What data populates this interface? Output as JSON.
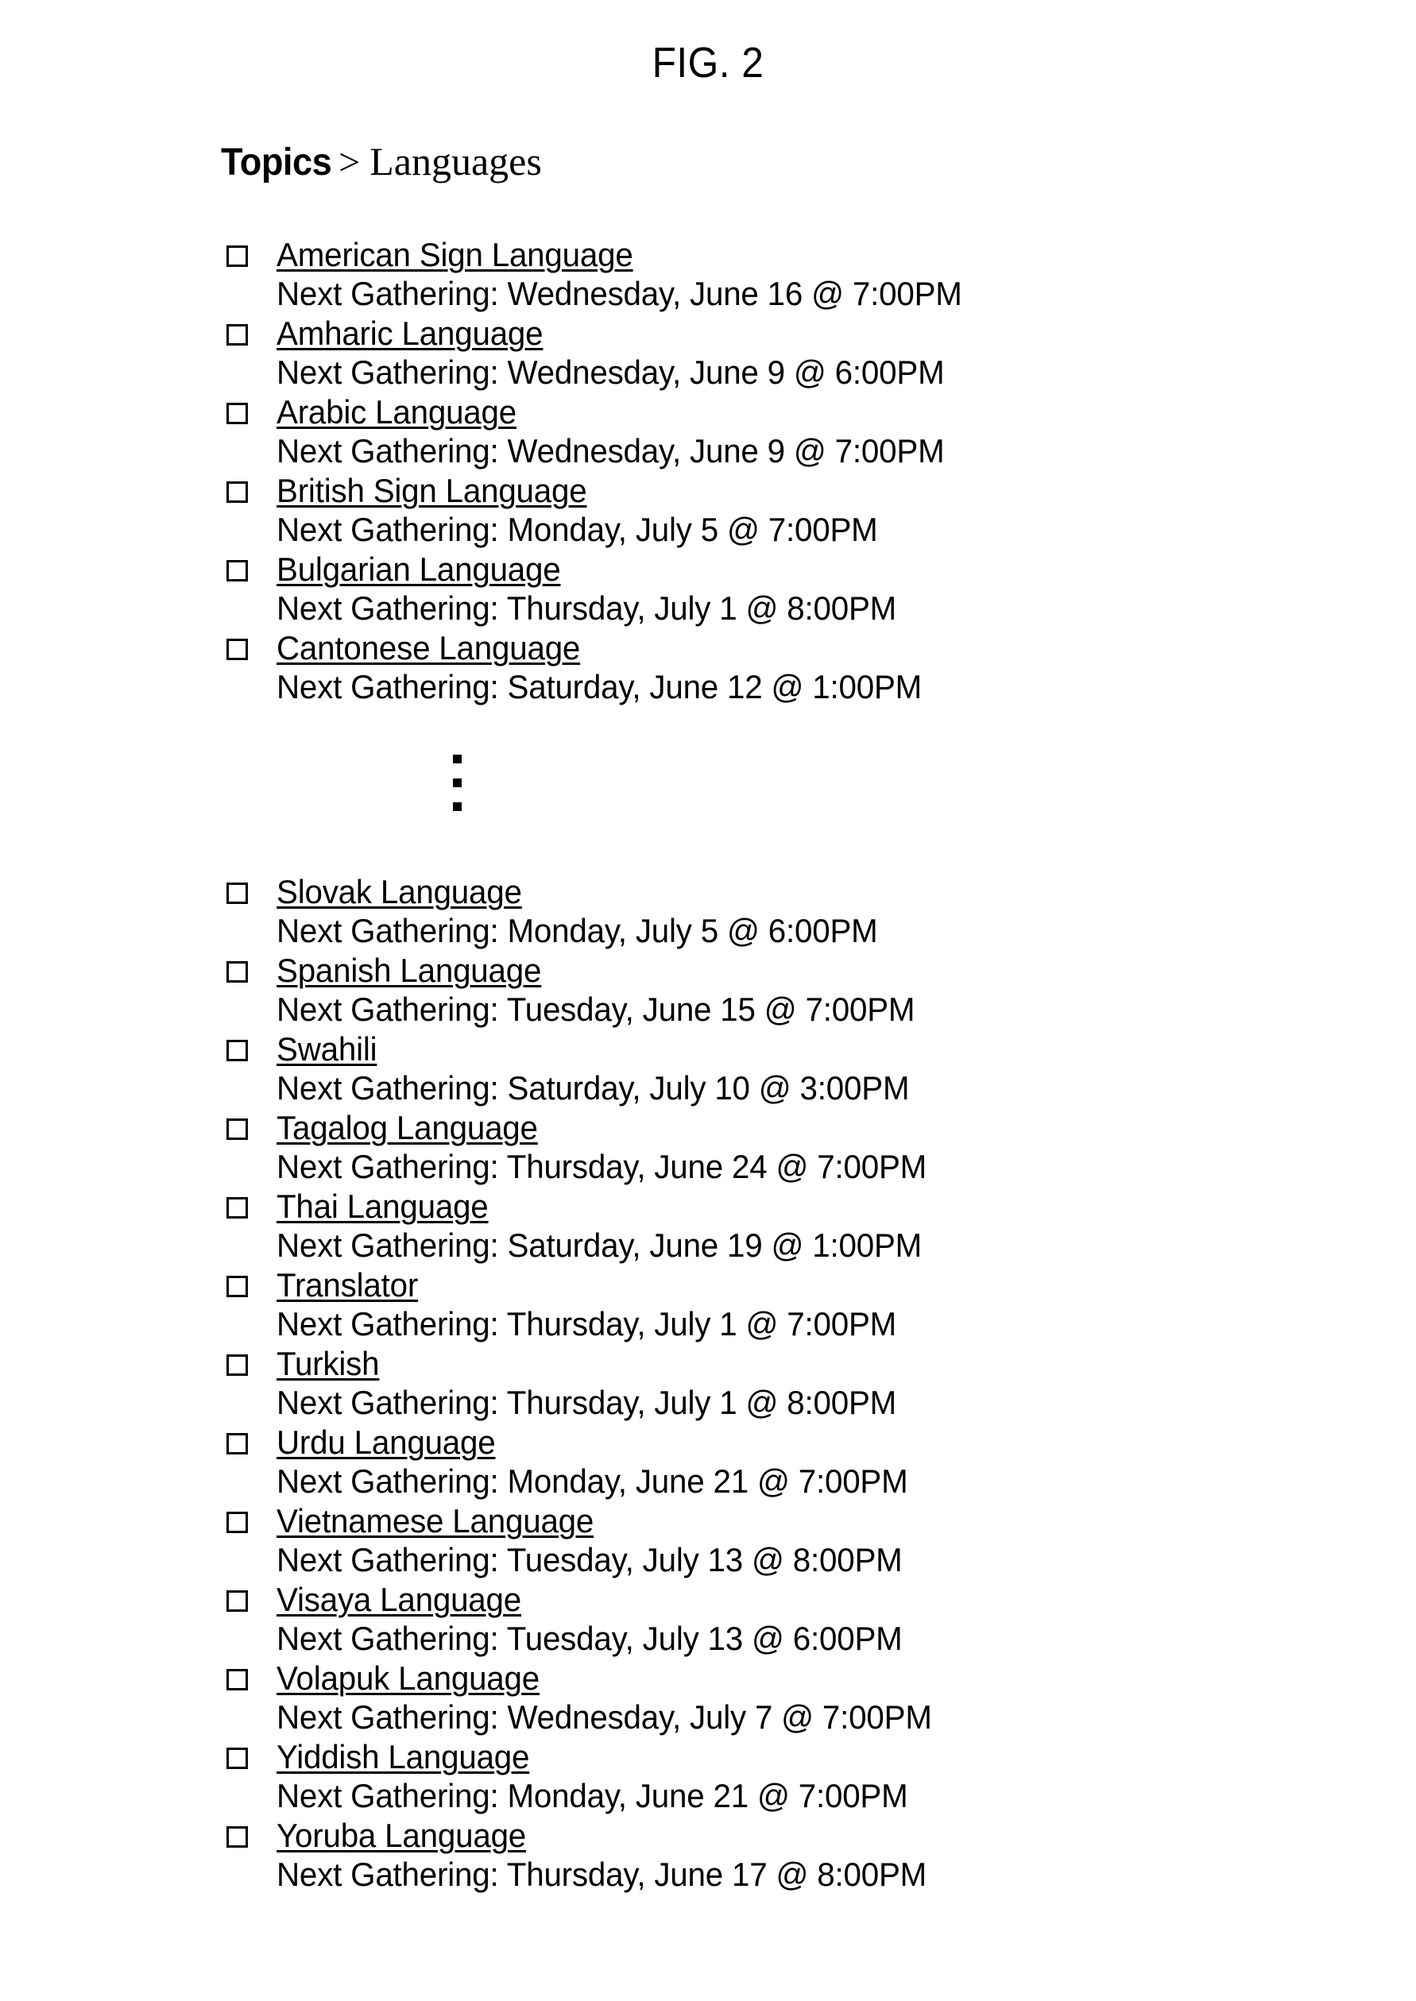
{
  "figure": {
    "label": "FIG. 2"
  },
  "breadcrumb": {
    "root": "Topics",
    "separator": ">",
    "leaf": "Languages"
  },
  "list": {
    "meta_prefix": "Next Gathering:",
    "bullet_icon": "shadowed-square-checkbox",
    "ellipsis_icon": "vertical-ellipsis"
  },
  "groups": [
    {
      "id": "group-1",
      "items": [
        {
          "name": "American Sign Language",
          "gathering": "Next Gathering: Wednesday, June 16 @ 7:00PM",
          "day": "Wednesday",
          "date": "June 16",
          "time": "7:00PM"
        },
        {
          "name": "Amharic Language",
          "gathering": "Next Gathering: Wednesday, June 9 @ 6:00PM",
          "day": "Wednesday",
          "date": "June 9",
          "time": "6:00PM"
        },
        {
          "name": "Arabic Language",
          "gathering": "Next Gathering: Wednesday, June 9 @ 7:00PM",
          "day": "Wednesday",
          "date": "June 9",
          "time": "7:00PM"
        },
        {
          "name": "British Sign Language",
          "gathering": "Next Gathering: Monday, July 5 @ 7:00PM",
          "day": "Monday",
          "date": "July 5",
          "time": "7:00PM"
        },
        {
          "name": "Bulgarian Language",
          "gathering": "Next Gathering: Thursday, July 1 @ 8:00PM",
          "day": "Thursday",
          "date": "July 1",
          "time": "8:00PM"
        },
        {
          "name": "Cantonese Language",
          "gathering": "Next Gathering: Saturday, June 12 @ 1:00PM",
          "day": "Saturday",
          "date": "June 12",
          "time": "1:00PM"
        }
      ]
    },
    {
      "id": "group-2",
      "items": [
        {
          "name": "Slovak Language",
          "gathering": "Next Gathering: Monday, July 5 @ 6:00PM",
          "day": "Monday",
          "date": "July 5",
          "time": "6:00PM"
        },
        {
          "name": "Spanish Language",
          "gathering": "Next Gathering: Tuesday, June 15 @ 7:00PM",
          "day": "Tuesday",
          "date": "June 15",
          "time": "7:00PM"
        },
        {
          "name": "Swahili",
          "gathering": "Next Gathering: Saturday, July 10 @ 3:00PM",
          "day": "Saturday",
          "date": "July 10",
          "time": "3:00PM"
        },
        {
          "name": "Tagalog Language",
          "gathering": "Next Gathering: Thursday, June 24 @ 7:00PM",
          "day": "Thursday",
          "date": "June 24",
          "time": "7:00PM"
        },
        {
          "name": "Thai Language",
          "gathering": "Next Gathering: Saturday, June 19 @ 1:00PM",
          "day": "Saturday",
          "date": "June 19",
          "time": "1:00PM"
        },
        {
          "name": "Translator",
          "gathering": "Next Gathering: Thursday, July 1 @ 7:00PM",
          "day": "Thursday",
          "date": "July 1",
          "time": "7:00PM"
        },
        {
          "name": "Turkish",
          "gathering": "Next Gathering: Thursday, July 1 @ 8:00PM",
          "day": "Thursday",
          "date": "July 1",
          "time": "8:00PM"
        },
        {
          "name": "Urdu Language",
          "gathering": "Next Gathering: Monday, June 21 @ 7:00PM",
          "day": "Monday",
          "date": "June 21",
          "time": "7:00PM"
        },
        {
          "name": "Vietnamese Language",
          "gathering": "Next Gathering: Tuesday, July 13 @ 8:00PM",
          "day": "Tuesday",
          "date": "July 13",
          "time": "8:00PM"
        },
        {
          "name": "Visaya Language",
          "gathering": "Next Gathering: Tuesday, July 13 @ 6:00PM",
          "day": "Tuesday",
          "date": "July 13",
          "time": "6:00PM"
        },
        {
          "name": "Volapuk Language",
          "gathering": "Next Gathering: Wednesday, July 7 @ 7:00PM",
          "day": "Wednesday",
          "date": "July 7",
          "time": "7:00PM"
        },
        {
          "name": "Yiddish Language",
          "gathering": "Next Gathering: Monday, June 21 @ 7:00PM",
          "day": "Monday",
          "date": "June 21",
          "time": "7:00PM"
        },
        {
          "name": "Yoruba Language",
          "gathering": "Next Gathering: Thursday, June 17 @ 8:00PM",
          "day": "Thursday",
          "date": "June 17",
          "time": "8:00PM"
        }
      ]
    }
  ]
}
